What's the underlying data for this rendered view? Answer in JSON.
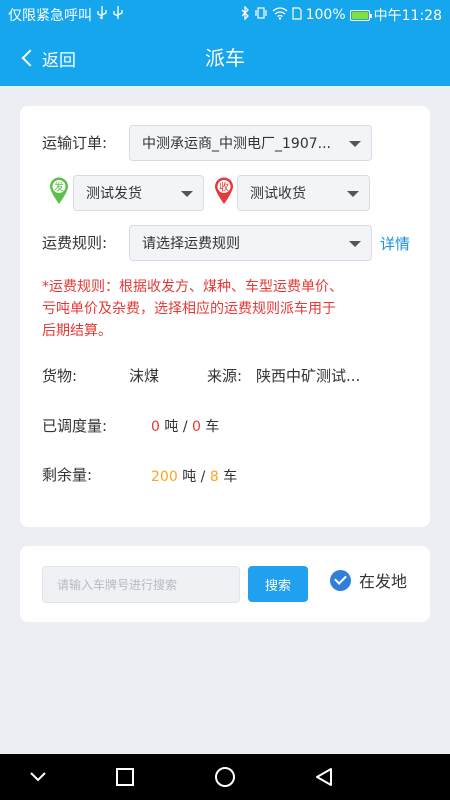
{
  "status_bar": {
    "carrier": "仅限紧急呼叫",
    "battery": "100%",
    "time": "中午11:28"
  },
  "nav": {
    "back_label": "返回",
    "title": "派车"
  },
  "form": {
    "order_label": "运输订单:",
    "order_value": "中测承运商_中测电厂_1907...",
    "send_icon_text": "发",
    "send_value": "测试发货",
    "receive_icon_text": "收",
    "receive_value": "测试收货",
    "freight_label": "运费规则:",
    "freight_value": "请选择运费规则",
    "detail_link": "详情",
    "note_line1": "*运费规则：根据收发方、煤种、车型运费单价、",
    "note_line2": "亏吨单价及杂费，选择相应的运费规则派车用于",
    "note_line3": "后期结算。",
    "goods_label": "货物:",
    "goods_value": "沫煤",
    "source_label": "来源:",
    "source_value": "陕西中矿测试...",
    "dispatched_label": "已调度量:",
    "dispatched_tons": "0",
    "dispatched_cars": "0",
    "remaining_label": "剩余量:",
    "remaining_tons": "200",
    "remaining_cars": "8",
    "unit_ton_sep": "吨 /",
    "unit_car": "车"
  },
  "search": {
    "placeholder": "请输入车牌号进行搜索",
    "button_label": "搜索",
    "checkbox_label": "在发地"
  },
  "colors": {
    "primary": "#16a6ee",
    "danger": "#e53935",
    "warning": "#f5a623",
    "link": "#1d8fe0"
  },
  "icons": [
    "usb-icon",
    "bluetooth-icon",
    "vibrate-icon",
    "wifi-icon",
    "battery-icon",
    "back-chevron-icon",
    "send-pin-icon",
    "receive-pin-icon",
    "dropdown-caret-icon",
    "check-circle-icon",
    "nav-back-icon",
    "nav-home-icon",
    "nav-recents-icon",
    "nav-down-icon"
  ]
}
